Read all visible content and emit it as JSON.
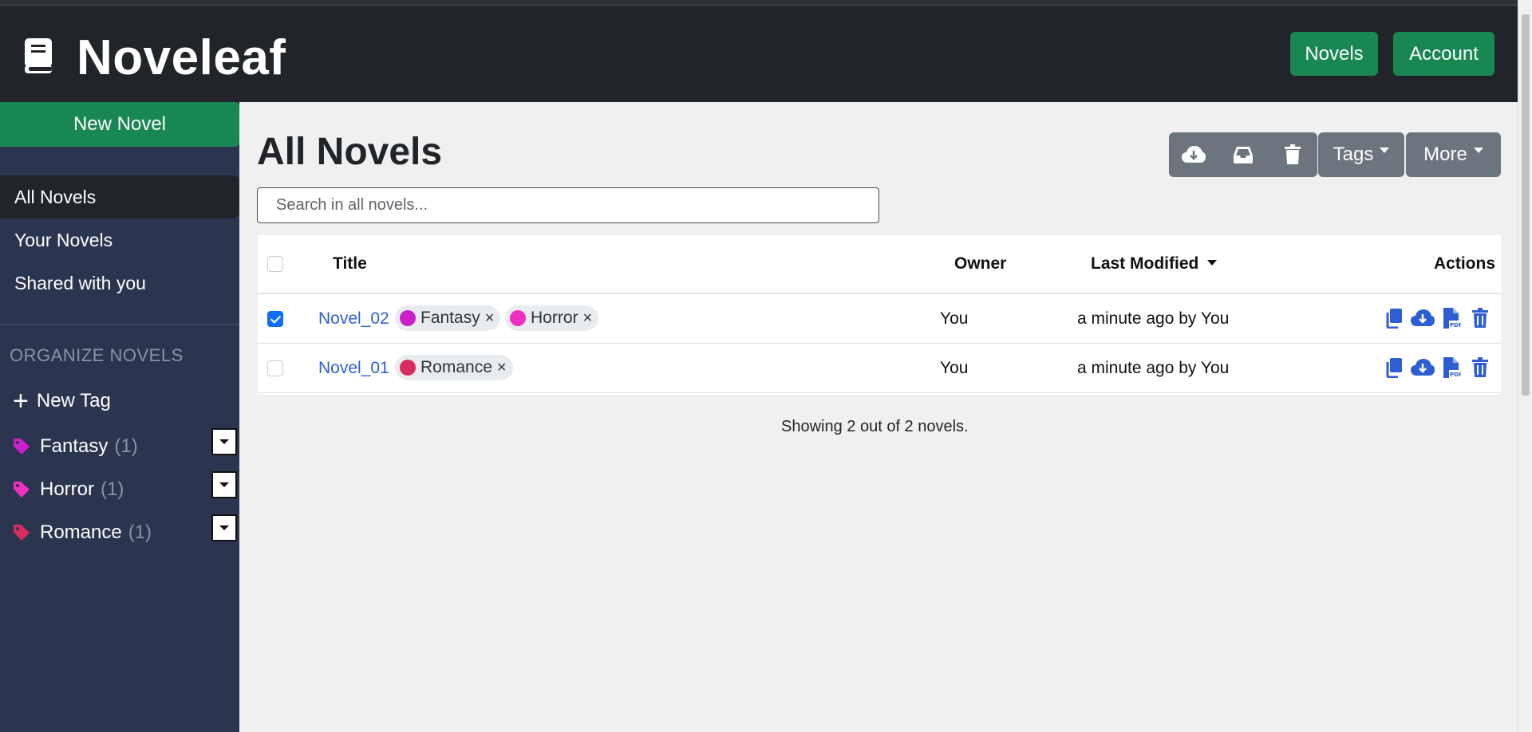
{
  "app": {
    "name": "Noveleaf",
    "nav": {
      "novels": "Novels",
      "account": "Account"
    }
  },
  "sidebar": {
    "new_novel": "New Novel",
    "items": [
      {
        "label": "All Novels",
        "active": true
      },
      {
        "label": "Your Novels",
        "active": false
      },
      {
        "label": "Shared with you",
        "active": false
      }
    ],
    "organize_heading": "ORGANIZE NOVELS",
    "new_tag": "New Tag",
    "tags": [
      {
        "name": "Fantasy",
        "count": "(1)",
        "color": "#cc1fcc"
      },
      {
        "name": "Horror",
        "count": "(1)",
        "color": "#f02fc1"
      },
      {
        "name": "Romance",
        "count": "(1)",
        "color": "#d92b60"
      }
    ]
  },
  "main": {
    "title": "All Novels",
    "search_placeholder": "Search in all novels...",
    "toolbar": {
      "icons": [
        "cloud-download-icon",
        "archive-icon",
        "trash-icon"
      ],
      "tags": "Tags",
      "more": "More"
    },
    "table": {
      "headers": {
        "title": "Title",
        "owner": "Owner",
        "last_modified": "Last Modified",
        "actions": "Actions"
      },
      "rows": [
        {
          "checked": true,
          "title": "Novel_02",
          "tags": [
            {
              "name": "Fantasy",
              "color": "#cc1fcc"
            },
            {
              "name": "Horror",
              "color": "#f02fc1"
            }
          ],
          "owner": "You",
          "last_modified": "a minute ago by You"
        },
        {
          "checked": false,
          "title": "Novel_01",
          "tags": [
            {
              "name": "Romance",
              "color": "#d92b60"
            }
          ],
          "owner": "You",
          "last_modified": "a minute ago by You"
        }
      ]
    },
    "showing": "Showing 2 out of 2 novels."
  },
  "colors": {
    "accent": "#198754",
    "link": "#2d5fd3",
    "sidebar": "#2c3550",
    "navbar": "#212529",
    "toolbar": "#6c757d"
  }
}
